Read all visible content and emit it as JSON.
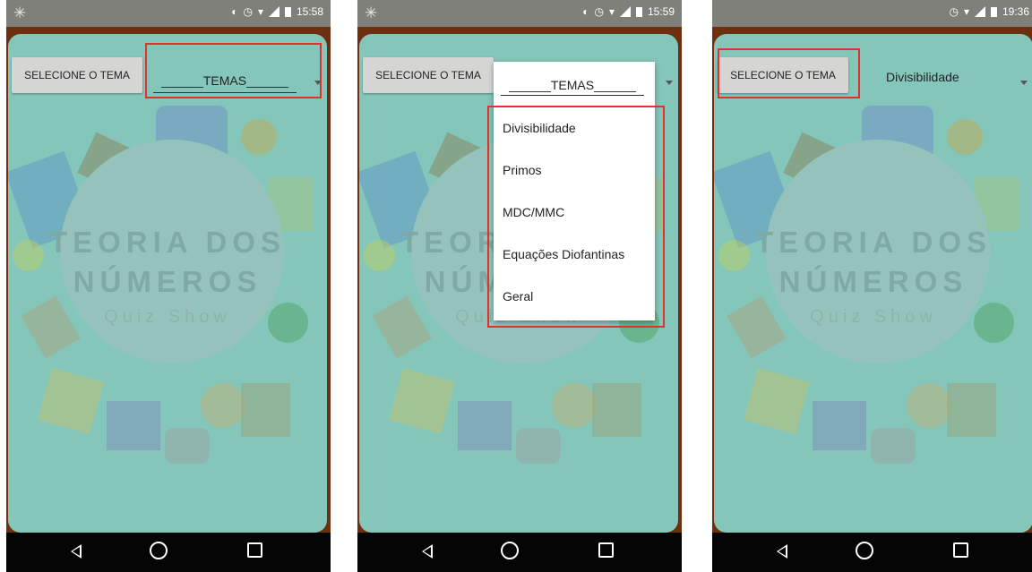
{
  "colors": {
    "app_background": "#84c7ba",
    "frame": "#6e2f10",
    "status_bar": "#7e8079",
    "nav_bar": "#050505",
    "highlight": "#e0312f",
    "button": "#d5d5d4"
  },
  "status": {
    "screen1_time": "15:58",
    "screen2_time": "15:59",
    "screen3_time": "19:36"
  },
  "app": {
    "select_button_label": "SELECIONE O TEMA",
    "spinner_placeholder": "______TEMAS______",
    "title_line1": "TEORIA DOS",
    "title_line2": "NÚMEROS",
    "subtitle": "Quiz Show"
  },
  "dropdown": {
    "options": [
      "Divisibilidade",
      "Primos",
      "MDC/MMC",
      "Equações Diofantinas",
      "Geral"
    ]
  },
  "screen3": {
    "selected_theme": "Divisibilidade"
  },
  "icons": {
    "nav": [
      "back-icon",
      "home-icon",
      "recents-icon"
    ],
    "status": [
      "debug-icon",
      "vibrate-icon",
      "alarm-icon",
      "wifi-icon",
      "signal-icon",
      "battery-icon"
    ]
  }
}
